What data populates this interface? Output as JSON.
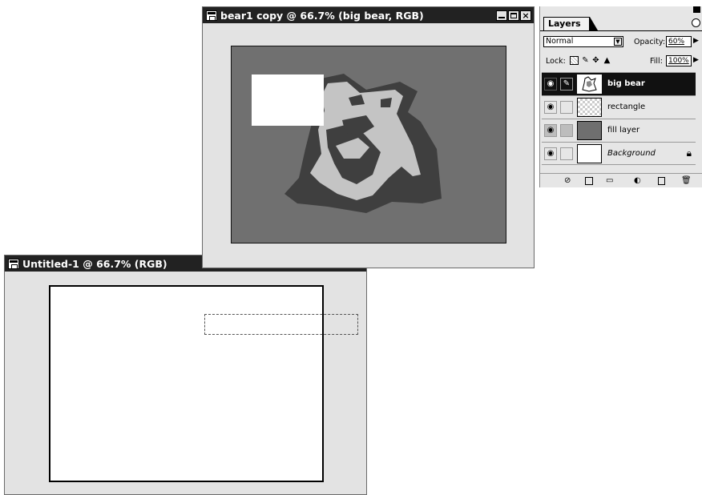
{
  "bear_window": {
    "title": "bear1 copy @ 66.7% (big bear, RGB)",
    "close_glyph": "×"
  },
  "untitled_window": {
    "title": "Untitled-1 @ 66.7% (RGB)"
  },
  "layers_panel": {
    "tab_label": "Layers",
    "blend_mode": "Normal",
    "opacity_label": "Opacity:",
    "opacity_value": "60%",
    "lock_label": "Lock:",
    "fill_label": "Fill:",
    "fill_value": "100%",
    "layers": [
      {
        "name": "big bear",
        "active": true,
        "thumb": "bear"
      },
      {
        "name": "rectangle",
        "active": false,
        "thumb": "checker"
      },
      {
        "name": "fill layer",
        "active": false,
        "thumb": "gray"
      },
      {
        "name": "Background",
        "active": false,
        "thumb": "white",
        "locked": true
      }
    ],
    "icons": {
      "eye": "eye-icon",
      "brush": "paintbrush-icon",
      "lock": "lock-icon"
    }
  },
  "colors": {
    "canvas_gray": "#707070",
    "bear_dark": "#3f3f3f",
    "bear_light": "#c4c4c4",
    "titlebar": "#222222",
    "window_bg": "#e3e3e3"
  }
}
